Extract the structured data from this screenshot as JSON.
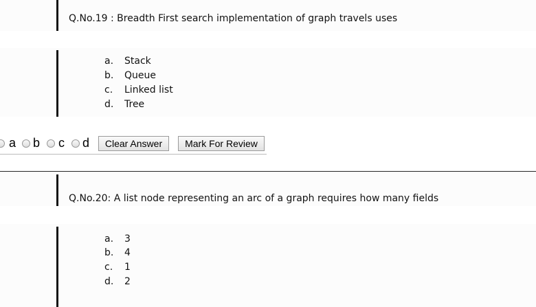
{
  "question19": {
    "text": "Q.No.19 : Breadth First search implementation of graph travels uses",
    "options": [
      {
        "letter": "a.",
        "text": "Stack"
      },
      {
        "letter": "b.",
        "text": "Queue"
      },
      {
        "letter": "c.",
        "text": "Linked list"
      },
      {
        "letter": "d.",
        "text": "Tree"
      }
    ]
  },
  "answer19": {
    "choices": [
      "a",
      "b",
      "c",
      "d"
    ],
    "clear_label": "Clear Answer",
    "review_label": "Mark For Review"
  },
  "question20": {
    "text": "Q.No.20: A list node representing an arc of a graph requires how many fields",
    "options": [
      {
        "letter": "a.",
        "text": "3"
      },
      {
        "letter": "b.",
        "text": "4"
      },
      {
        "letter": "c.",
        "text": "1"
      },
      {
        "letter": "d.",
        "text": "2"
      }
    ]
  }
}
